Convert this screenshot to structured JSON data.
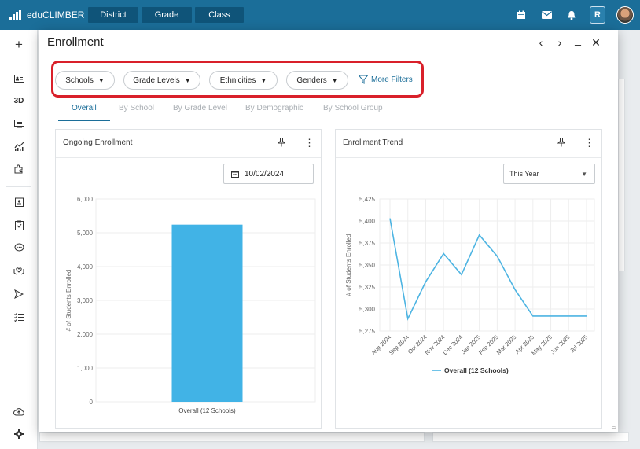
{
  "app": {
    "brand": "eduCLIMBER",
    "nav": [
      "District",
      "Grade",
      "Class"
    ],
    "avatar_initial": "R"
  },
  "modal": {
    "title": "Enrollment",
    "filters": [
      "Schools",
      "Grade Levels",
      "Ethnicities",
      "Genders"
    ],
    "more_filters": "More Filters",
    "tabs": [
      "Overall",
      "By School",
      "By Grade Level",
      "By Demographic",
      "By School Group"
    ],
    "active_tab": "Overall"
  },
  "ongoing": {
    "title": "Ongoing Enrollment",
    "date": "10/02/2024"
  },
  "trend": {
    "title": "Enrollment Trend",
    "period": "This Year"
  },
  "colors": {
    "brand": "#1b6e99",
    "bar": "#41b3e6",
    "line": "#4db4e2",
    "highlight": "#d9202a"
  },
  "chart_data": [
    {
      "type": "bar",
      "title": "Ongoing Enrollment",
      "categories": [
        "Overall (12 Schools)"
      ],
      "values": [
        5240
      ],
      "ylabel": "# of Students Enrolled",
      "ylim": [
        0,
        6000
      ],
      "yticks": [
        "0",
        "1,000",
        "2,000",
        "3,000",
        "4,000",
        "5,000",
        "6,000"
      ]
    },
    {
      "type": "line",
      "title": "Enrollment Trend",
      "x": [
        "Aug 2024",
        "Sep 2024",
        "Oct 2024",
        "Nov 2024",
        "Dec 2024",
        "Jan 2025",
        "Feb 2025",
        "Mar 2025",
        "Apr 2025",
        "May 2025",
        "Jun 2025",
        "Jul 2025"
      ],
      "series": [
        {
          "name": "Overall (12 Schools)",
          "values": [
            5403,
            5289,
            5331,
            5363,
            5339,
            5384,
            5360,
            5322,
            5292,
            5292,
            5292,
            5292
          ]
        }
      ],
      "ylabel": "# of Students Enrolled",
      "ylim": [
        5275,
        5425
      ],
      "yticks": [
        "5,275",
        "5,300",
        "5,325",
        "5,350",
        "5,375",
        "5,400",
        "5,425"
      ],
      "legend": "bottom"
    }
  ]
}
